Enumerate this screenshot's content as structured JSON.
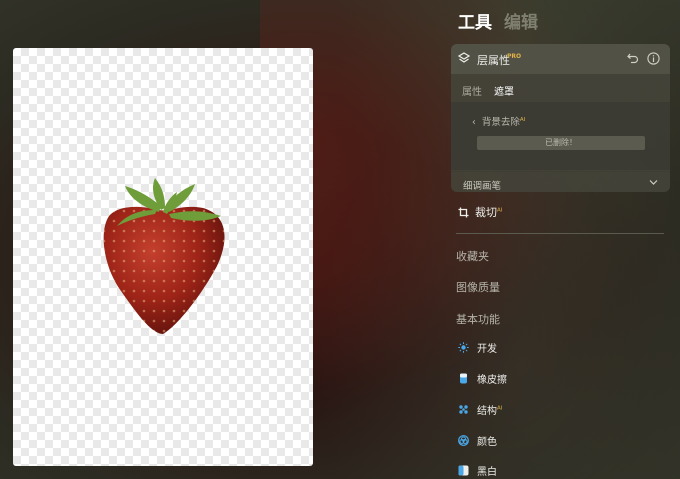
{
  "header": {
    "tabs": [
      {
        "label": "工具",
        "active": true
      },
      {
        "label": "编辑",
        "active": false
      }
    ]
  },
  "layer_panel": {
    "title": "层属性",
    "badge": "PRO",
    "icons": [
      "layers-icon",
      "undo-icon",
      "info-icon"
    ],
    "sub_tabs": [
      {
        "label": "属性",
        "active": false
      },
      {
        "label": "遮罩",
        "active": true
      }
    ],
    "back_label": "背景去除",
    "back_badge": "AI",
    "status_button": "已删除！",
    "brush_label": "细调画笔"
  },
  "crop": {
    "label": "裁切",
    "badge": "AI"
  },
  "sections": [
    "收藏夹",
    "图像质量",
    "基本功能"
  ],
  "functions": [
    {
      "label": "开发",
      "icon": "sun-icon",
      "color": "#4aa8e8"
    },
    {
      "label": "橡皮擦",
      "icon": "eraser-icon",
      "color": "#4aa8e8"
    },
    {
      "label": "结构",
      "badge": "AI",
      "icon": "structure-icon",
      "color": "#4aa8e8"
    },
    {
      "label": "颜色",
      "icon": "color-icon",
      "color": "#4aa8e8"
    },
    {
      "label": "黑白",
      "icon": "black-white-icon",
      "color": "#4aa8e8"
    }
  ],
  "colors": {
    "accent_badge": "#e0b24a",
    "icon_blue": "#4aa8e8"
  }
}
